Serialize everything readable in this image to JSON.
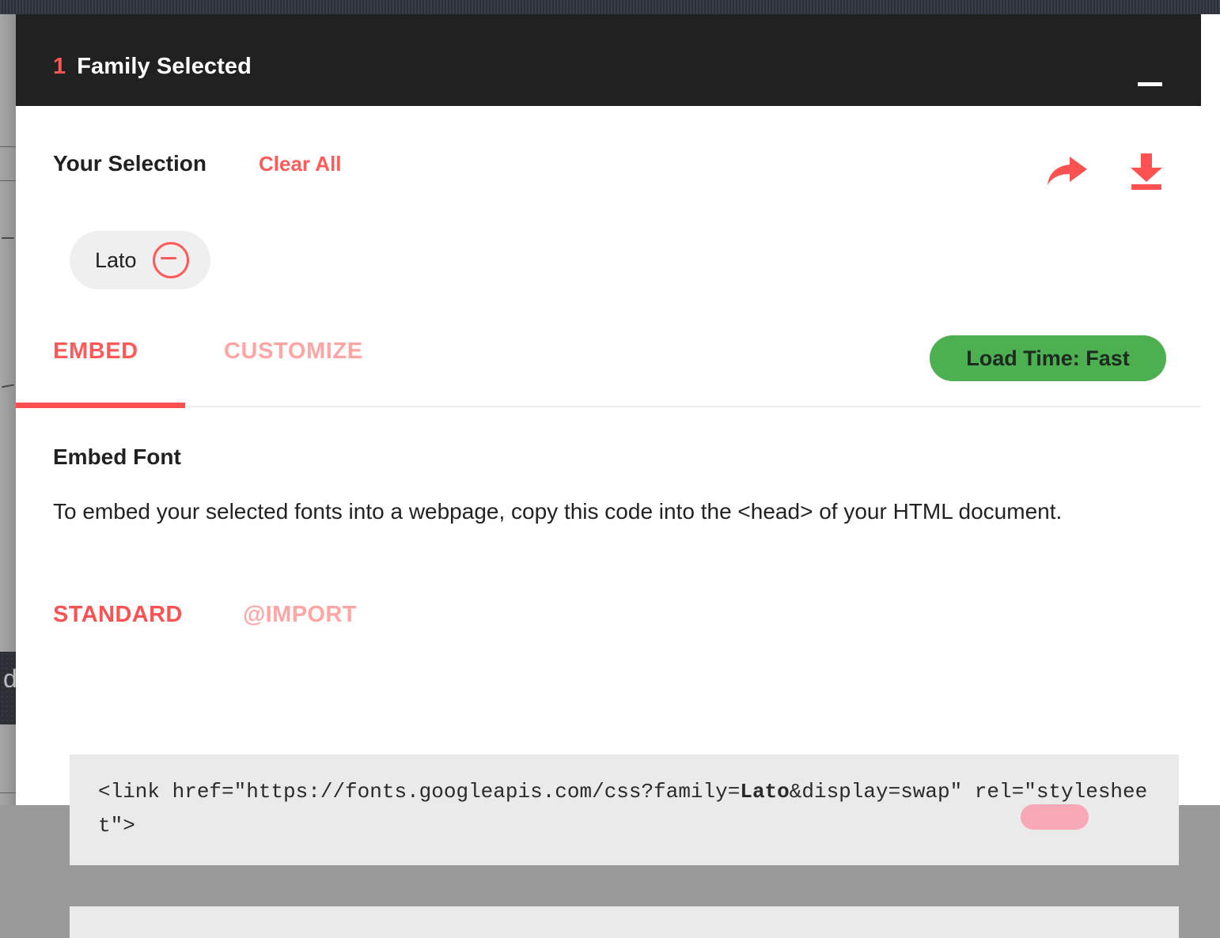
{
  "window": {
    "header": {
      "count": "1",
      "title": "Family Selected",
      "minimize_label": "minimize"
    }
  },
  "selection": {
    "title": "Your Selection",
    "clear_all_label": "Clear All",
    "share_icon": "share-icon",
    "download_icon": "download-icon",
    "chips": [
      {
        "label": "Lato",
        "remove_icon": "remove-circle-icon"
      }
    ]
  },
  "tabs": {
    "items": [
      {
        "label": "EMBED",
        "active": true
      },
      {
        "label": "CUSTOMIZE",
        "active": false
      }
    ],
    "embed_label": "EMBED",
    "customize_label": "CUSTOMIZE"
  },
  "load_time": {
    "label": "Load Time: Fast",
    "color": "#4caf50"
  },
  "embed": {
    "heading": "Embed Font",
    "description": "To embed your selected fonts into a webpage, copy this code into the <head> of your HTML document.",
    "subtabs": {
      "standard_label": "STANDARD",
      "import_label": "@IMPORT"
    },
    "code_prefix": "<link href=\"https://fonts.googleapis.com/css?family=",
    "code_family": "Lato",
    "code_suffix": "&display=swap\" rel=\"stylesheet\">"
  },
  "background": {
    "card_letter": "d"
  },
  "colors": {
    "accent": "#ff5a5a",
    "accent_light": "#ffa5a3",
    "header_bg": "#212121",
    "chip_bg": "#efefef",
    "code_bg": "#eaeaea",
    "badge_green": "#4caf50",
    "pink_mark": "#f9a8b8"
  }
}
